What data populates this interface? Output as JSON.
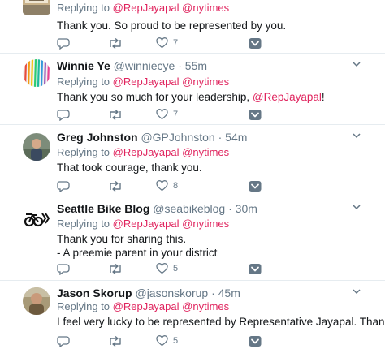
{
  "tweets": [
    {
      "name": "",
      "handle": "",
      "time": "",
      "replying_prefix": "Replying to ",
      "mention1": "@RepJayapal",
      "mention2": "@nytimes",
      "lines": [
        "Thank you.  So proud to be represented by you."
      ],
      "mention_in_text": "",
      "text_suffix": "",
      "reply_count": "",
      "retweet_count": "",
      "like_count": "7",
      "avatar_icon": "avatar-sign-icon"
    },
    {
      "name": "Winnie Ye",
      "handle": "@winniecye",
      "time": "55m",
      "replying_prefix": "Replying to ",
      "mention1": "@RepJayapal",
      "mention2": "@nytimes",
      "lines": [
        "Thank you so much for your leadership, "
      ],
      "mention_in_text": "@RepJayapal",
      "text_suffix": "!",
      "reply_count": "",
      "retweet_count": "",
      "like_count": "7",
      "avatar_icon": "avatar-rainbow-icon"
    },
    {
      "name": "Greg Johnston",
      "handle": "@GPJohnston",
      "time": "54m",
      "replying_prefix": "Replying to ",
      "mention1": "@RepJayapal",
      "mention2": "@nytimes",
      "lines": [
        "That took courage, thank you."
      ],
      "mention_in_text": "",
      "text_suffix": "",
      "reply_count": "",
      "retweet_count": "",
      "like_count": "8",
      "avatar_icon": "avatar-photo-icon"
    },
    {
      "name": "Seattle Bike Blog",
      "handle": "@seabikeblog",
      "time": "30m",
      "replying_prefix": "Replying to ",
      "mention1": "@RepJayapal",
      "mention2": "@nytimes",
      "lines": [
        "Thank you for sharing this.",
        "- A preemie parent in your district"
      ],
      "mention_in_text": "",
      "text_suffix": "",
      "reply_count": "",
      "retweet_count": "",
      "like_count": "5",
      "avatar_icon": "avatar-bike-logo-icon"
    },
    {
      "name": "Jason Skorup",
      "handle": "@jasonskorup",
      "time": "45m",
      "replying_prefix": "Replying to ",
      "mention1": "@RepJayapal",
      "mention2": "@nytimes",
      "lines": [
        "I feel very lucky to be represented by Representative Jayapal. Thank you!"
      ],
      "mention_in_text": "",
      "text_suffix": "",
      "reply_count": "",
      "retweet_count": "",
      "like_count": "5",
      "avatar_icon": "avatar-photo-icon"
    }
  ],
  "colors": {
    "mention": "#e0245e",
    "secondary_text": "#657786",
    "divider": "#e6ecf0",
    "dm_icon": "#657786"
  },
  "icons": {
    "reply": "reply-icon",
    "retweet": "retweet-icon",
    "like": "heart-icon",
    "dm": "direct-message-icon",
    "caret": "chevron-down-icon"
  }
}
